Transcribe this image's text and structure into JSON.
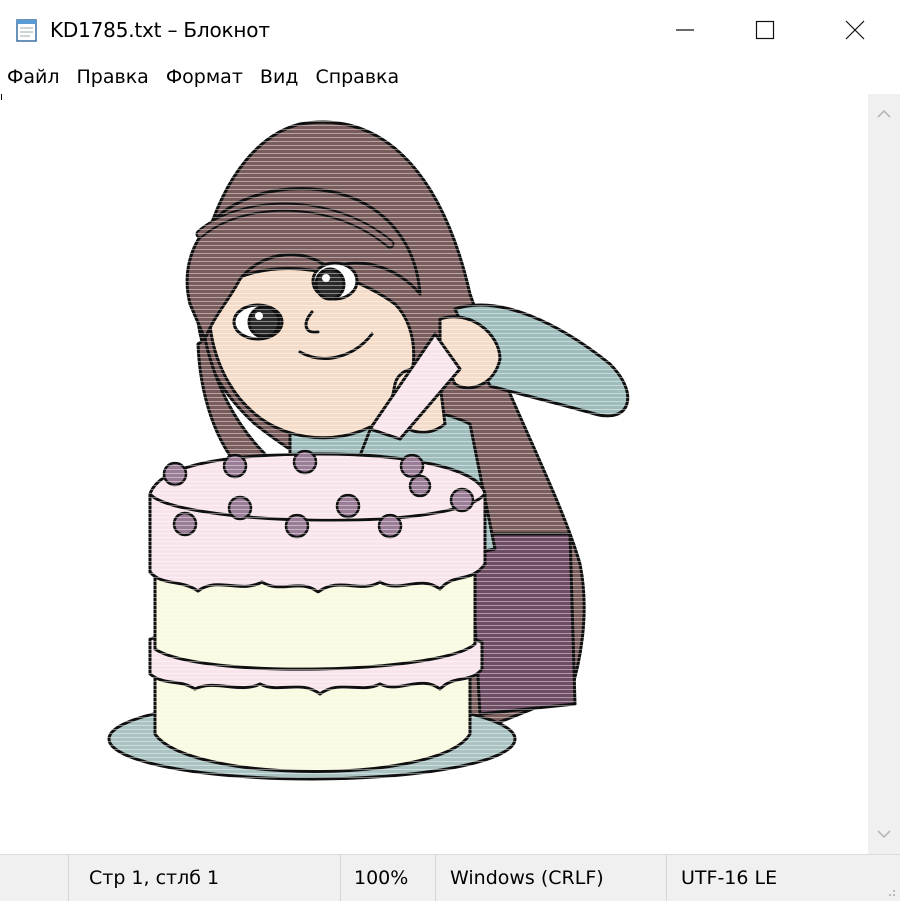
{
  "window": {
    "title": "KD1785.txt – Блокнот",
    "icon": "notepad-icon"
  },
  "controls": {
    "minimize_icon": "minimize-icon",
    "maximize_icon": "maximize-icon",
    "close_icon": "close-icon"
  },
  "menu": {
    "items": [
      "Файл",
      "Правка",
      "Формат",
      "Вид",
      "Справка"
    ]
  },
  "editor": {
    "content_image": "girl decorating a layered cake with a piping bag",
    "colors": {
      "hair": "#7a5c5c",
      "skin": "#f5dcc8",
      "shirt": "#9fbcbc",
      "skirt": "#6e4d64",
      "frosting": "#f8e4ea",
      "cake": "#fafae0",
      "plate": "#a9c2c2",
      "roses": "#9a7c96",
      "outline": "#101010"
    }
  },
  "status": {
    "position": "Стр 1, стлб 1",
    "zoom": "100%",
    "line_endings": "Windows (CRLF)",
    "encoding": "UTF-16 LE"
  }
}
